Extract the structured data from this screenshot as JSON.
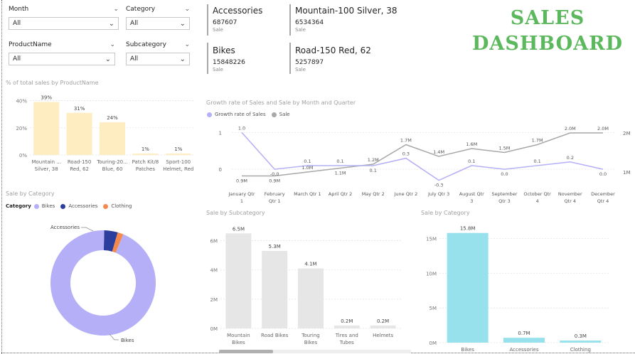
{
  "slicers": [
    {
      "label": "Month",
      "value": "All"
    },
    {
      "label": "Category",
      "value": "All"
    },
    {
      "label": "ProductName",
      "value": "All"
    },
    {
      "label": "Subcategory",
      "value": "All"
    }
  ],
  "cards": [
    {
      "title": "Accessories",
      "value": "687607",
      "sub": "Sale"
    },
    {
      "title": "Mountain-100 Silver, 38",
      "value": "6534364",
      "sub": "Sale"
    },
    {
      "title": "Bikes",
      "value": "15848226",
      "sub": "Sale"
    },
    {
      "title": "Road-150 Red, 62",
      "value": "5257897",
      "sub": "Sale"
    }
  ],
  "dashboard_title": {
    "line1": "SALES",
    "line2": "DASHBOARD"
  },
  "colors": {
    "title_green": "#5cb85c",
    "bar_cream": "#fdedc0",
    "bar_gray": "#e6e6e6",
    "bar_cyan": "#96e1ec",
    "purple": "#b4aff7",
    "line_gray": "#a8a8a8",
    "navy": "#2b3e9e",
    "orange": "#f5894b"
  },
  "chart_data": [
    {
      "type": "bar",
      "title": "% of total sales by ProductName",
      "categories": [
        "Mountain ... Silver, 38",
        "Road-150 Red, 62",
        "Touring-20... Blue, 60",
        "Patch Kit/8 Patches",
        "Sport-100 Helmet, Red"
      ],
      "category_lines": [
        [
          "Mountain ...",
          "Silver, 38"
        ],
        [
          "Road-150",
          "Red, 62"
        ],
        [
          "Touring-20...",
          "Blue, 60"
        ],
        [
          "Patch Kit/8",
          "Patches"
        ],
        [
          "Sport-100",
          "Helmet, Red"
        ]
      ],
      "values": [
        39,
        31,
        24,
        1,
        1
      ],
      "data_labels": [
        "39%",
        "31%",
        "24%",
        "1%",
        "1%"
      ],
      "ylim": [
        0,
        45
      ],
      "yticks": [
        0,
        20,
        40
      ],
      "ytick_labels": [
        "0%",
        "20%",
        "40%"
      ]
    },
    {
      "type": "line",
      "title": "Growth rate of Sales and Sale by Month and Quarter",
      "categories": [
        "January Qtr 1",
        "February Qtr 1",
        "March Qtr 1",
        "April Qtr 2",
        "May Qtr 2",
        "June Qtr 2",
        "July Qtr 3",
        "August Qtr 3",
        "September Qtr 3",
        "October Qtr 4",
        "November Qtr 4",
        "December Qtr 4"
      ],
      "category_lines": [
        [
          "January Qtr",
          "1"
        ],
        [
          "February",
          "Qtr 1"
        ],
        [
          "March Qtr 1",
          ""
        ],
        [
          "April Qtr 2",
          ""
        ],
        [
          "May Qtr 2",
          ""
        ],
        [
          "June Qtr 2",
          ""
        ],
        [
          "July Qtr 3",
          ""
        ],
        [
          "August Qtr",
          "3"
        ],
        [
          "September",
          "Qtr 3"
        ],
        [
          "October Qtr",
          "4"
        ],
        [
          "November",
          "Qtr 4"
        ],
        [
          "December",
          "Qtr 4"
        ]
      ],
      "series": [
        {
          "name": "Growth rate of Sales",
          "values": [
            1.0,
            -0.0,
            0.1,
            0.1,
            0.1,
            0.3,
            -0.3,
            0.1,
            -0.0,
            0.1,
            0.2,
            -0.0
          ],
          "labels": [
            "1.0",
            "-0.0",
            "0.1",
            "0.1",
            "0.1",
            "0.3",
            "-0.3",
            "0.1",
            "0.0",
            "0.1",
            "0.2",
            "0.0"
          ],
          "color": "#b4aff7"
        },
        {
          "name": "Sale",
          "values": [
            0.9,
            0.9,
            1.0,
            1.1,
            1.2,
            1.7,
            1.4,
            1.6,
            1.5,
            1.7,
            2.0,
            2.0
          ],
          "labels": [
            "0.9M",
            "0.9M",
            "1.0M",
            "1.1M",
            "1.2M",
            "1.7M",
            "1.4M",
            "1.6M",
            "1.5M",
            "1.7M",
            "2.0M",
            "2.0M"
          ],
          "color": "#a8a8a8"
        }
      ],
      "left_axis": {
        "ylim": [
          -0.5,
          1.2
        ],
        "ticks": [
          "1",
          "0"
        ]
      },
      "right_axis": {
        "ylim": [
          0.6,
          2.2
        ],
        "ticks": [
          "2M",
          "1M"
        ]
      }
    },
    {
      "type": "pie",
      "title": "Sale by Category",
      "legend_title": "Category",
      "slices": [
        {
          "name": "Bikes",
          "value": 15.8,
          "color": "#b4aff7"
        },
        {
          "name": "Accessories",
          "value": 0.7,
          "color": "#2b3e9e"
        },
        {
          "name": "Clothing",
          "value": 0.3,
          "color": "#f5894b"
        }
      ],
      "outside_labels": [
        "Accessories",
        "Bikes"
      ]
    },
    {
      "type": "bar",
      "title": "Sale by Subcategory",
      "categories": [
        "Mountain Bikes",
        "Road Bikes",
        "Touring Bikes",
        "Tires and Tubes",
        "Helmets"
      ],
      "category_lines": [
        [
          "Mountain",
          "Bikes"
        ],
        [
          "Road Bikes",
          ""
        ],
        [
          "Touring",
          "Bikes"
        ],
        [
          "Tires and",
          "Tubes"
        ],
        [
          "Helmets",
          ""
        ]
      ],
      "values": [
        6.5,
        5.3,
        4.1,
        0.2,
        0.2
      ],
      "data_labels": [
        "6.5M",
        "5.3M",
        "4.1M",
        "0.2M",
        "0.2M"
      ],
      "ylim": [
        0,
        7
      ],
      "yticks": [
        0,
        2,
        4,
        6
      ],
      "ytick_labels": [
        "0M",
        "2M",
        "4M",
        "6M"
      ]
    },
    {
      "type": "bar",
      "title": "Sale by Category",
      "categories": [
        "Bikes",
        "Accessories",
        "Clothing"
      ],
      "category_lines": [
        [
          "Bikes",
          ""
        ],
        [
          "Accessories",
          ""
        ],
        [
          "Clothing",
          ""
        ]
      ],
      "values": [
        15.8,
        0.7,
        0.3
      ],
      "data_labels": [
        "15.8M",
        "0.7M",
        "0.3M"
      ],
      "ylim": [
        0,
        17
      ],
      "yticks": [
        0,
        5,
        10,
        15
      ],
      "ytick_labels": [
        "0M",
        "5M",
        "10M",
        "15M"
      ]
    }
  ]
}
